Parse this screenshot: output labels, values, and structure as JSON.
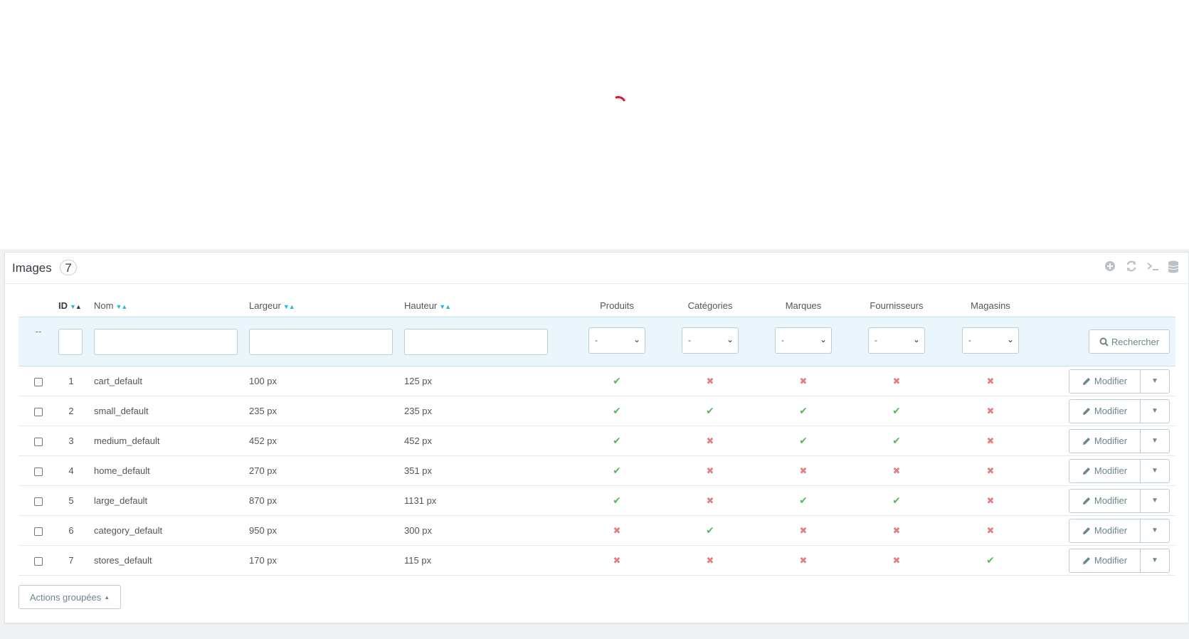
{
  "panel": {
    "title": "Images",
    "count": "7"
  },
  "toolbar_icons": [
    "add-new-icon",
    "refresh-icon",
    "sql-query-icon",
    "export-database-icon"
  ],
  "columns": {
    "id": "ID",
    "name": "Nom",
    "width": "Largeur",
    "height": "Hauteur",
    "products": "Produits",
    "categories": "Catégories",
    "brands": "Marques",
    "suppliers": "Fournisseurs",
    "stores": "Magasins"
  },
  "filters": {
    "bulk_marker": "--",
    "select_value": "-",
    "search_label": "Rechercher"
  },
  "rows": [
    {
      "id": "1",
      "name": "cart_default",
      "width": "100 px",
      "height": "125 px",
      "products": true,
      "categories": false,
      "brands": false,
      "suppliers": false,
      "stores": false
    },
    {
      "id": "2",
      "name": "small_default",
      "width": "235 px",
      "height": "235 px",
      "products": true,
      "categories": true,
      "brands": true,
      "suppliers": true,
      "stores": false
    },
    {
      "id": "3",
      "name": "medium_default",
      "width": "452 px",
      "height": "452 px",
      "products": true,
      "categories": false,
      "brands": true,
      "suppliers": true,
      "stores": false
    },
    {
      "id": "4",
      "name": "home_default",
      "width": "270 px",
      "height": "351 px",
      "products": true,
      "categories": false,
      "brands": false,
      "suppliers": false,
      "stores": false
    },
    {
      "id": "5",
      "name": "large_default",
      "width": "870 px",
      "height": "1131 px",
      "products": true,
      "categories": false,
      "brands": true,
      "suppliers": true,
      "stores": false
    },
    {
      "id": "6",
      "name": "category_default",
      "width": "950 px",
      "height": "300 px",
      "products": false,
      "categories": true,
      "brands": false,
      "suppliers": false,
      "stores": false
    },
    {
      "id": "7",
      "name": "stores_default",
      "width": "170 px",
      "height": "115 px",
      "products": false,
      "categories": false,
      "brands": false,
      "suppliers": false,
      "stores": true
    }
  ],
  "row_actions": {
    "edit_label": "Modifier"
  },
  "bulk_actions": {
    "label": "Actions groupées"
  },
  "colors": {
    "accent": "#25b9d7",
    "enabled": "#5cb85c",
    "disabled": "#e08080",
    "spinner": "#e1172a"
  }
}
